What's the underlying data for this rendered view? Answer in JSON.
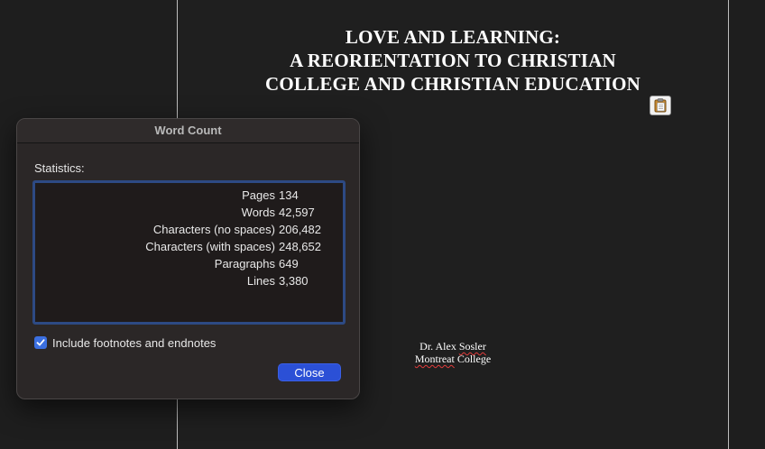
{
  "document": {
    "title_lines": [
      "LOVE AND LEARNING:",
      "A REORIENTATION TO CHRISTIAN",
      "COLLEGE AND CHRISTIAN EDUCATION"
    ],
    "author_first": "Dr. Alex ",
    "author_last": "Sosler",
    "institution_word1": "Montreat",
    "institution_word2": " College"
  },
  "dialog": {
    "title": "Word Count",
    "statistics_label": "Statistics:",
    "stats": [
      {
        "label": "Pages",
        "value": "134"
      },
      {
        "label": "Words",
        "value": "42,597"
      },
      {
        "label": "Characters (no spaces)",
        "value": "206,482"
      },
      {
        "label": "Characters (with spaces)",
        "value": "248,652"
      },
      {
        "label": "Paragraphs",
        "value": "649"
      },
      {
        "label": "Lines",
        "value": "3,380"
      }
    ],
    "include_footnotes_label": "Include footnotes and endnotes",
    "close_label": "Close"
  },
  "icons": {
    "paste": "clipboard-icon",
    "check": "checkmark-icon"
  },
  "colors": {
    "accent": "#2b50d6",
    "focus_border": "#2d4a84",
    "checkbox": "#3b6fe0",
    "spell_error": "#e23c3c"
  }
}
